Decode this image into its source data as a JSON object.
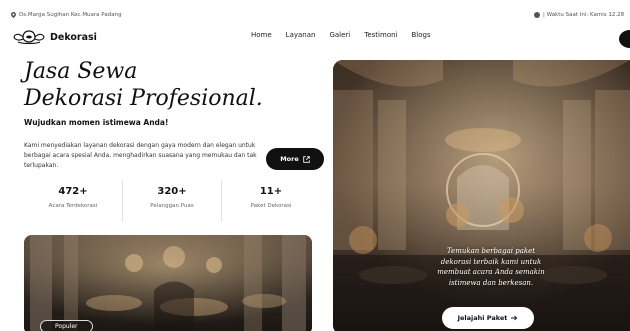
{
  "topbar": {
    "address": "Ds.Marga Sugihan Kec.Muara Padang",
    "time_label": "| Waktu Saat Ini: Kamis 12.28"
  },
  "brand": {
    "name": "Dekorasi",
    "logo_icon": "ornament-logo-icon"
  },
  "nav": {
    "items": [
      "Home",
      "Layanan",
      "Galeri",
      "Testimoni",
      "Blogs"
    ]
  },
  "hero": {
    "title_line1": "Jasa Sewa",
    "title_line2": "Dekorasi Profesional.",
    "subtitle": "Wujudkan momen istimewa Anda!",
    "description": "Kami menyediakan layanan dekorasi dengan gaya modern dan elegan untuk berbagai acara spesial Anda, menghadirkan suasana yang memukau dan tak terlupakan.",
    "more_button": "More"
  },
  "stats": [
    {
      "value": "472+",
      "label": "Acara Terdekorasi"
    },
    {
      "value": "320+",
      "label": "Pelanggan Puas"
    },
    {
      "value": "11+",
      "label": "Paket Dekorasi"
    }
  ],
  "cards": {
    "left_badge": "Populer",
    "right_caption": "Temukan berbagai paket dekorasi terbaik kami untuk membuat acara Anda semakin istimewa dan berkesan.",
    "right_button": "Jelajahi Paket"
  },
  "colors": {
    "primary": "#111111",
    "accent_gold": "#c9a46a",
    "text_muted": "#666666"
  }
}
